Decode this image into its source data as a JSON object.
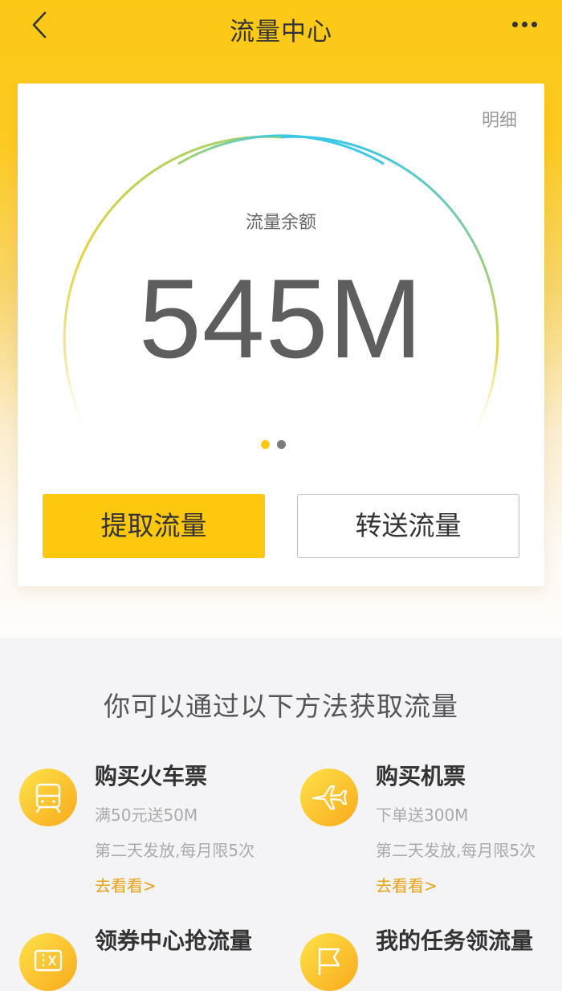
{
  "header": {
    "title": "流量中心",
    "back_icon": "chevron-left-icon",
    "more_icon": "more-dots-icon"
  },
  "card": {
    "detail_link": "明细",
    "balance_label": "流量余额",
    "balance_value": "545M",
    "pager": {
      "total": 2,
      "active": 0
    },
    "buttons": {
      "extract": "提取流量",
      "transfer": "转送流量"
    }
  },
  "methods": {
    "title": "你可以通过以下方法获取流量",
    "items": [
      {
        "icon": "train-icon",
        "title": "购买火车票",
        "line1": "满50元送50M",
        "line2": "第二天发放,每月限5次",
        "link": "去看看>"
      },
      {
        "icon": "airplane-icon",
        "title": "购买机票",
        "line1": "下单送300M",
        "line2": "第二天发放,每月限5次",
        "link": "去看看>"
      },
      {
        "icon": "coupon-icon",
        "title": "领券中心抢流量"
      },
      {
        "icon": "flag-icon",
        "title": "我的任务领流量"
      }
    ]
  },
  "colors": {
    "accent": "#fdc80d",
    "link": "#e8a216",
    "gauge_start": "#3cc8e6",
    "gauge_end": "#e7cf2c"
  }
}
